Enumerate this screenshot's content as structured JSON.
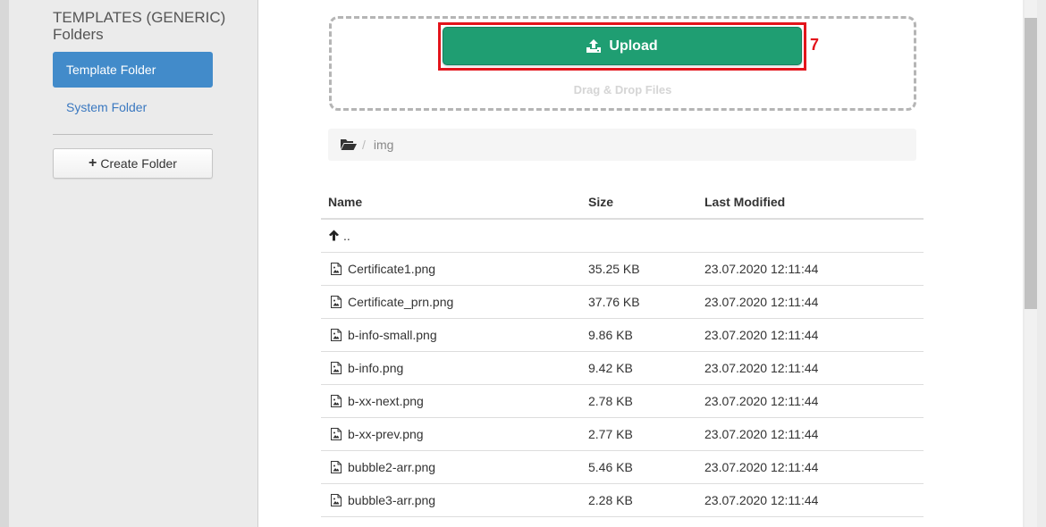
{
  "sidebar": {
    "title": "TEMPLATES (GENERIC) Folders",
    "items": [
      {
        "label": "Template Folder",
        "active": true
      },
      {
        "label": "System Folder",
        "active": false
      }
    ],
    "create_button": "Create Folder"
  },
  "upload": {
    "button_label": "Upload",
    "button_icon": "upload-icon",
    "annotation_number": "7",
    "drag_drop_label": "Drag & Drop Files"
  },
  "breadcrumb": {
    "icon": "folder-open-icon",
    "separator": "/",
    "current": "img"
  },
  "table": {
    "headers": {
      "name": "Name",
      "size": "Size",
      "modified": "Last Modified"
    },
    "parent_label": "..",
    "rows": [
      {
        "name": "Certificate1.png",
        "size": "35.25 KB",
        "modified": "23.07.2020 12:11:44"
      },
      {
        "name": "Certificate_prn.png",
        "size": "37.76 KB",
        "modified": "23.07.2020 12:11:44"
      },
      {
        "name": "b-info-small.png",
        "size": "9.86 KB",
        "modified": "23.07.2020 12:11:44"
      },
      {
        "name": "b-info.png",
        "size": "9.42 KB",
        "modified": "23.07.2020 12:11:44"
      },
      {
        "name": "b-xx-next.png",
        "size": "2.78 KB",
        "modified": "23.07.2020 12:11:44"
      },
      {
        "name": "b-xx-prev.png",
        "size": "2.77 KB",
        "modified": "23.07.2020 12:11:44"
      },
      {
        "name": "bubble2-arr.png",
        "size": "5.46 KB",
        "modified": "23.07.2020 12:11:44"
      },
      {
        "name": "bubble3-arr.png",
        "size": "2.28 KB",
        "modified": "23.07.2020 12:11:44"
      }
    ]
  },
  "colors": {
    "primary": "#428bca",
    "upload_green": "#1f9e72",
    "annotation_red": "#e3141b"
  }
}
